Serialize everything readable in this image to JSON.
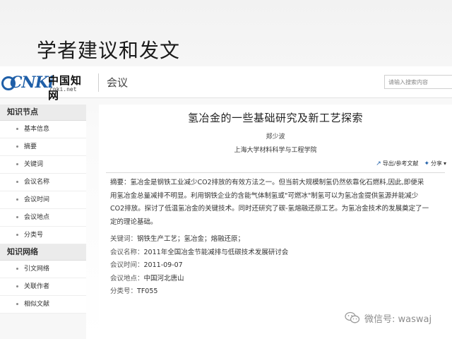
{
  "slide": {
    "title": "学者建议和发文"
  },
  "header": {
    "logo_word": "CNKi",
    "logo_cn": "中国知网",
    "logo_url": "cnki.net",
    "section": "会议",
    "search_placeholder": "请输入搜索内容"
  },
  "sidebar": {
    "sections": [
      {
        "label": "知识节点",
        "items": [
          "基本信息",
          "摘要",
          "关键词",
          "会议名称",
          "会议时间",
          "会议地点",
          "分类号"
        ]
      },
      {
        "label": "知识网络",
        "items": [
          "引文网络",
          "关联作者",
          "相似文献"
        ]
      }
    ]
  },
  "paper": {
    "title": "氢冶金的一些基础研究及新工艺探索",
    "author": "郑少波",
    "affiliation": "上海大学材料科学与工程学院",
    "tools": {
      "export": "导出/参考文献",
      "share": "分享"
    },
    "abstract_lines": [
      "摘要：氢冶金是钢铁工业减少CO2排放的有效方法之一。但当前大规模制氢仍然依靠化石燃料,因此,即便采",
      "用氢冶金总量减排不明显。利用钢铁企业的含能气体制氢或\"可燃冰\"制氢可以为氢冶金提供氢源并能减少",
      "CO2排放。探讨了低温氢冶金的关键技术。同时还研究了碳-氢熔融还原工艺。为氢冶金技术的发展奠定了一",
      "定的理论基础。"
    ],
    "meta": [
      {
        "key": "关键词：",
        "value": "钢铁生产工艺；氢冶金；熔融还原；"
      },
      {
        "key": "会议名称：",
        "value": "2011年全国冶金节能减排与低碳技术发展研讨会"
      },
      {
        "key": "会议时间：",
        "value": "2011-09-07"
      },
      {
        "key": "会议地点：",
        "value": "中国河北唐山"
      },
      {
        "key": "分类号：",
        "value": "TF055"
      }
    ]
  },
  "watermark": {
    "text": "微信号: waswaj"
  }
}
